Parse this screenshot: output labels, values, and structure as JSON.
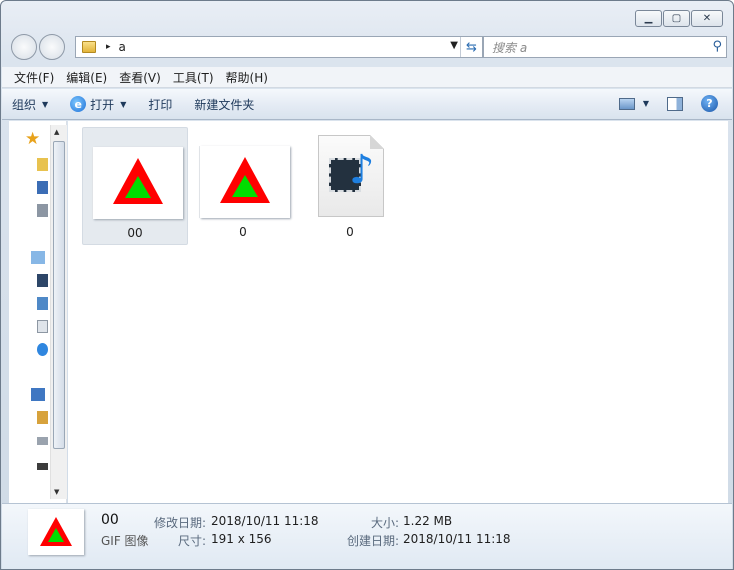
{
  "window": {
    "minimize_label": "▁",
    "maximize_label": "▢",
    "close_label": "✕"
  },
  "address": {
    "path": "a",
    "separator": "▸"
  },
  "search": {
    "placeholder": "搜索 a"
  },
  "menu": [
    "文件(F)",
    "编辑(E)",
    "查看(V)",
    "工具(T)",
    "帮助(H)"
  ],
  "toolbar": {
    "organize": "组织",
    "open": "打开",
    "print": "打印",
    "new_folder": "新建文件夹"
  },
  "items": [
    {
      "name": "00",
      "kind": "gif",
      "selected": true
    },
    {
      "name": "0",
      "kind": "gif",
      "selected": false
    },
    {
      "name": "0",
      "kind": "video",
      "selected": false
    }
  ],
  "details": {
    "name": "00",
    "type": "GIF 图像",
    "modified_label": "修改日期:",
    "modified_value": "2018/10/11 11:18",
    "dimensions_label": "尺寸:",
    "dimensions_value": "191 x 156",
    "size_label": "大小:",
    "size_value": "1.22 MB",
    "created_label": "创建日期:",
    "created_value": "2018/10/11 11:18"
  },
  "colors": {
    "triangle_outer": "#ff0000",
    "triangle_inner": "#00dd00",
    "selection": "#e5eaef"
  }
}
